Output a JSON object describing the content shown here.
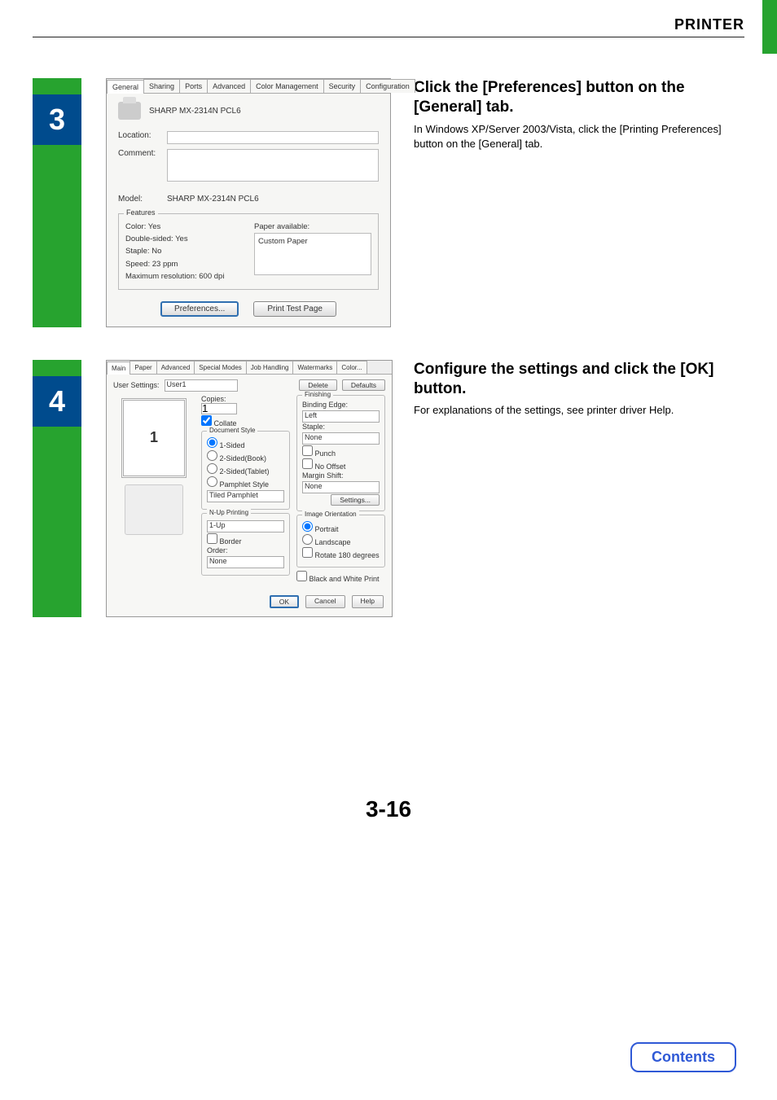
{
  "doc": {
    "chapter": "PRINTER",
    "page_number": "3-16",
    "contents_button": "Contents"
  },
  "step3": {
    "number": "3",
    "title": "Click the [Preferences] button on the [General] tab.",
    "desc": "In Windows XP/Server 2003/Vista, click the [Printing Preferences] button on the [General] tab.",
    "dlg": {
      "tabs": {
        "general": "General",
        "sharing": "Sharing",
        "ports": "Ports",
        "advanced": "Advanced",
        "color": "Color Management",
        "security": "Security",
        "config": "Configuration"
      },
      "printer_name": "SHARP MX-2314N PCL6",
      "location_lbl": "Location:",
      "comment_lbl": "Comment:",
      "model_lbl": "Model:",
      "model_val": "SHARP MX-2314N PCL6",
      "features_title": "Features",
      "f_color": "Color: Yes",
      "f_double": "Double-sided: Yes",
      "f_staple": "Staple: No",
      "f_speed": "Speed: 23 ppm",
      "f_res": "Maximum resolution: 600 dpi",
      "paper_avail_lbl": "Paper available:",
      "paper_item": "Custom Paper",
      "btn_prefs": "Preferences...",
      "btn_test": "Print Test Page"
    }
  },
  "step4": {
    "number": "4",
    "title": "Configure the settings and click the [OK] button.",
    "desc": "For explanations of the settings, see printer driver Help.",
    "dlg": {
      "tabs": {
        "main": "Main",
        "paper": "Paper",
        "advanced": "Advanced",
        "special": "Special Modes",
        "job": "Job Handling",
        "water": "Watermarks",
        "color": "Color..."
      },
      "usr_lbl": "User Settings:",
      "usr_val": "User1",
      "btn_delete": "Delete",
      "btn_defaults": "Defaults",
      "copies_lbl": "Copies:",
      "copies_val": "1",
      "collate_lbl": "Collate",
      "docstyle_title": "Document Style",
      "ds1": "1-Sided",
      "ds2": "2-Sided(Book)",
      "ds3": "2-Sided(Tablet)",
      "ds4": "Pamphlet Style",
      "tiled": "Tiled Pamphlet",
      "nup_title": "N-Up Printing",
      "nup_val": "1-Up",
      "border_lbl": "Border",
      "order_lbl": "Order:",
      "order_val": "None",
      "finish_title": "Finishing",
      "bind_lbl": "Binding Edge:",
      "bind_val": "Left",
      "staple_lbl": "Staple:",
      "staple_val": "None",
      "punch_lbl": "Punch",
      "nooff_lbl": "No Offset",
      "margin_lbl": "Margin Shift:",
      "margin_val": "None",
      "settings_btn": "Settings...",
      "orient_title": "Image Orientation",
      "orient_p": "Portrait",
      "orient_l": "Landscape",
      "rot_lbl": "Rotate 180 degrees",
      "bw_lbl": "Black and White Print",
      "btn_ok": "OK",
      "btn_cancel": "Cancel",
      "btn_help": "Help",
      "preview_num": "1"
    }
  }
}
